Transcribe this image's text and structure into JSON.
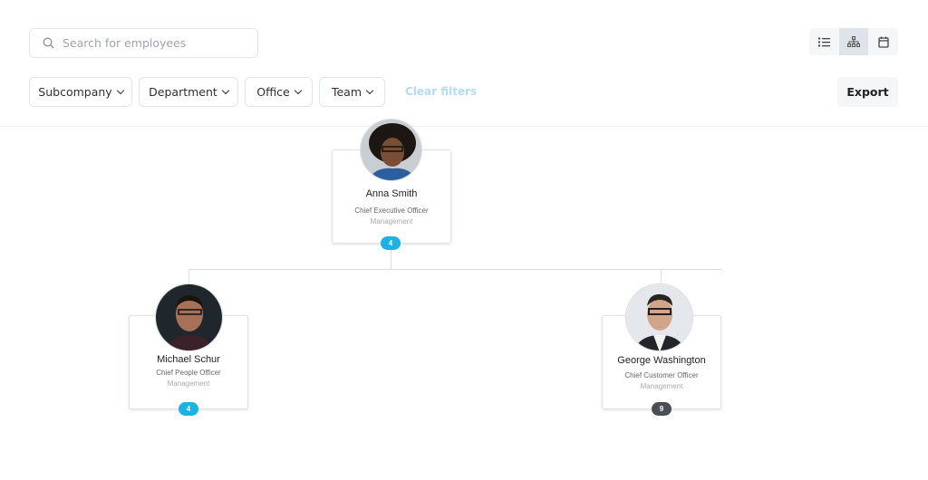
{
  "search": {
    "placeholder": "Search for employees"
  },
  "filters": [
    {
      "label": "Subcompany"
    },
    {
      "label": "Department"
    },
    {
      "label": "Office"
    },
    {
      "label": "Team"
    }
  ],
  "clear_filters": "Clear filters",
  "views": [
    {
      "icon": "list-icon"
    },
    {
      "icon": "org-chart-icon",
      "active": true
    },
    {
      "icon": "calendar-icon"
    }
  ],
  "export": "Export",
  "colors": {
    "badge_blue": "#1bb3e3",
    "badge_dark": "#4a4f55",
    "clear": "#b4dcf2"
  },
  "employees": [
    {
      "name": "Anna Smith",
      "role": "Chief Executive Officer",
      "department": "Management",
      "reports": "4"
    },
    {
      "name": "Michael Schur",
      "role": "Chief People Officer",
      "department": "Management",
      "reports": "4"
    },
    {
      "name": "George Washington",
      "role": "Chief Customer Officer",
      "department": "Management",
      "reports": "9"
    }
  ]
}
